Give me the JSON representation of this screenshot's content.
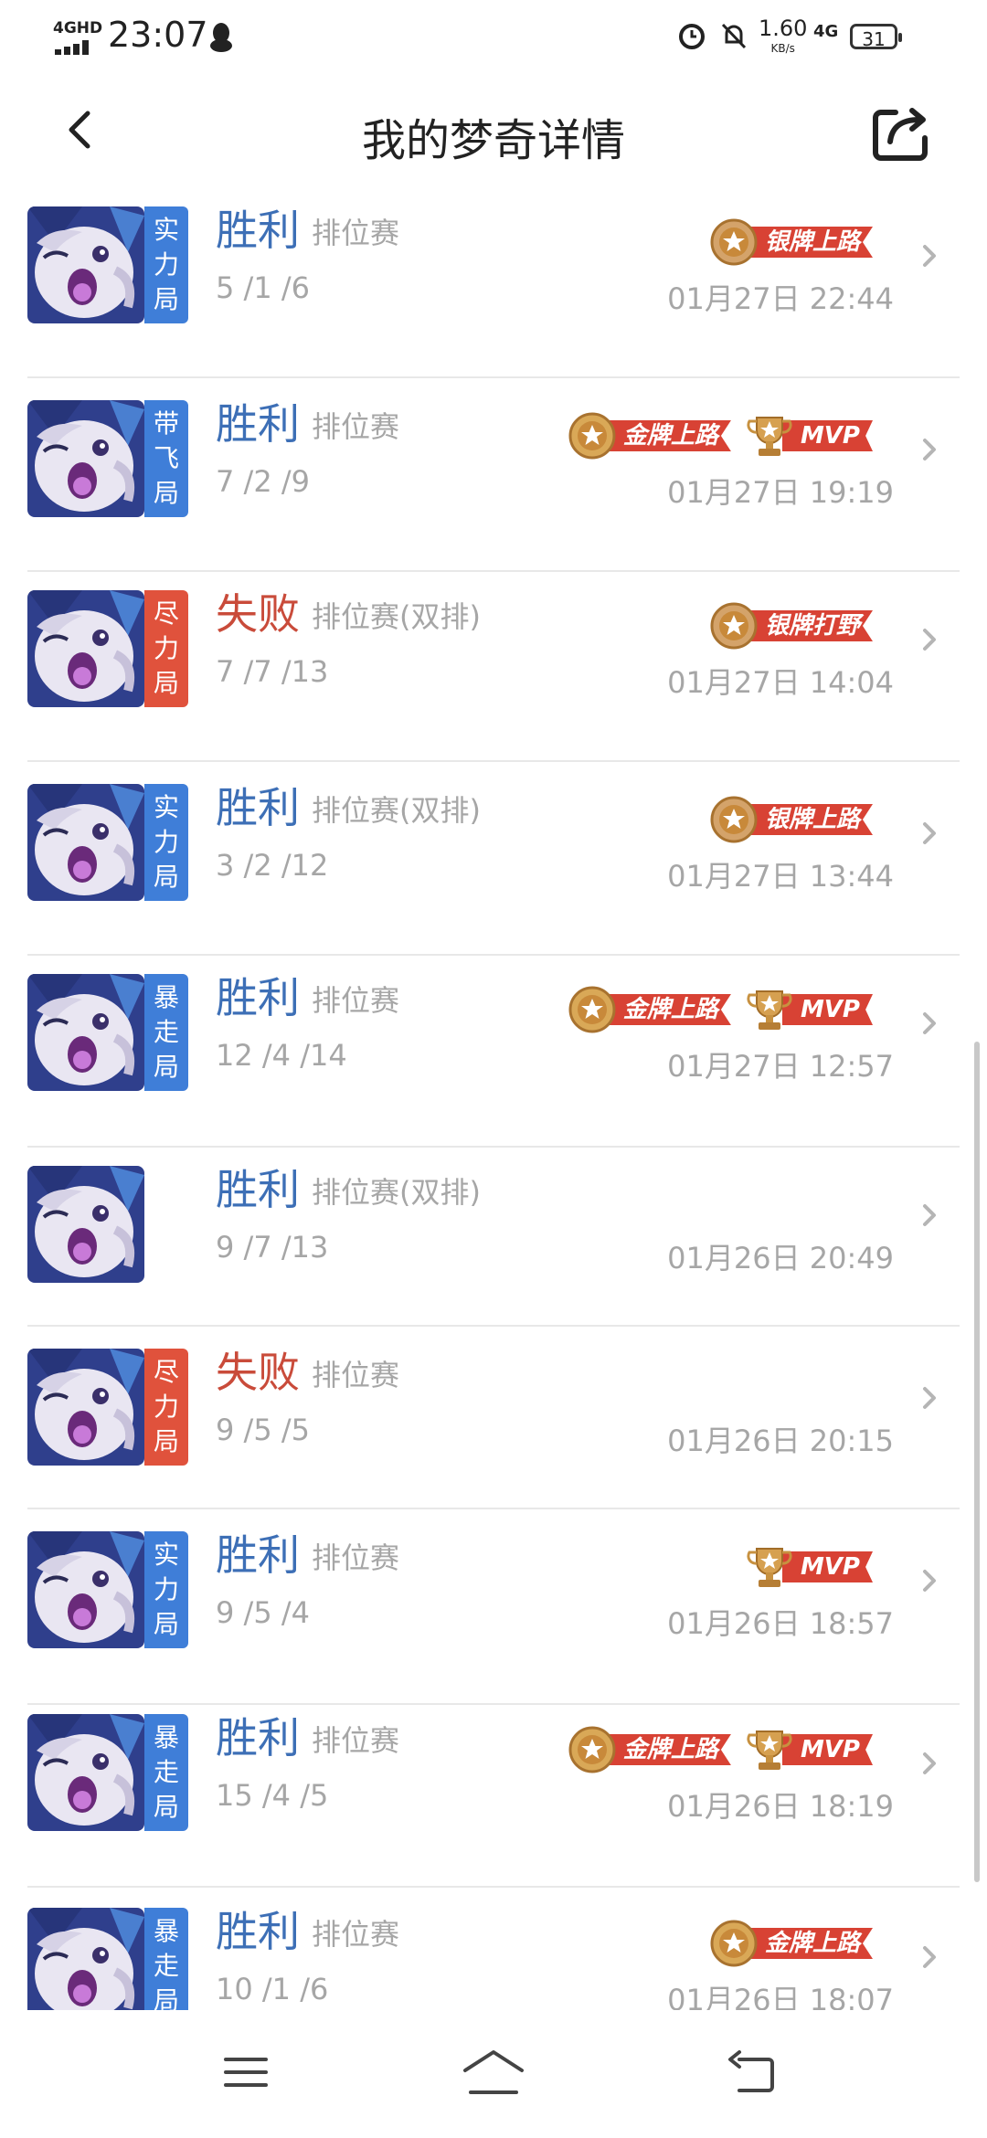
{
  "status_bar": {
    "network": "4GHD",
    "time": "23:07",
    "speed": "1.60",
    "speed_unit": "KB/s",
    "right_network": "4G",
    "battery": "31"
  },
  "header": {
    "title": "我的梦奇详情"
  },
  "matches": [
    {
      "tag": [
        "实",
        "力",
        "局"
      ],
      "tag_color": "#3f7ed8",
      "result": "胜利",
      "outcome": "win",
      "mode": "排位赛",
      "kda": "5 /1 /6",
      "time": "01月27日 22:44",
      "badges": [
        {
          "type": "silver",
          "label": "银牌上路"
        }
      ]
    },
    {
      "tag": [
        "带",
        "飞",
        "局"
      ],
      "tag_color": "#3f7ed8",
      "result": "胜利",
      "outcome": "win",
      "mode": "排位赛",
      "kda": "7 /2 /9",
      "time": "01月27日 19:19",
      "badges": [
        {
          "type": "gold",
          "label": "金牌上路"
        },
        {
          "type": "mvp",
          "label": "MVP"
        }
      ]
    },
    {
      "tag": [
        "尽",
        "力",
        "局"
      ],
      "tag_color": "#e0523c",
      "result": "失败",
      "outcome": "lose",
      "mode": "排位赛(双排)",
      "kda": "7 /7 /13",
      "time": "01月27日 14:04",
      "badges": [
        {
          "type": "silver",
          "label": "银牌打野"
        }
      ]
    },
    {
      "tag": [
        "实",
        "力",
        "局"
      ],
      "tag_color": "#3f7ed8",
      "result": "胜利",
      "outcome": "win",
      "mode": "排位赛(双排)",
      "kda": "3 /2 /12",
      "time": "01月27日 13:44",
      "badges": [
        {
          "type": "silver",
          "label": "银牌上路"
        }
      ]
    },
    {
      "tag": [
        "暴",
        "走",
        "局"
      ],
      "tag_color": "#3f7ed8",
      "result": "胜利",
      "outcome": "win",
      "mode": "排位赛",
      "kda": "12 /4 /14",
      "time": "01月27日 12:57",
      "badges": [
        {
          "type": "gold",
          "label": "金牌上路"
        },
        {
          "type": "mvp",
          "label": "MVP"
        }
      ]
    },
    {
      "tag": [],
      "tag_color": "",
      "result": "胜利",
      "outcome": "win",
      "mode": "排位赛(双排)",
      "kda": "9 /7 /13",
      "time": "01月26日 20:49",
      "badges": []
    },
    {
      "tag": [
        "尽",
        "力",
        "局"
      ],
      "tag_color": "#e0523c",
      "result": "失败",
      "outcome": "lose",
      "mode": "排位赛",
      "kda": "9 /5 /5",
      "time": "01月26日 20:15",
      "badges": []
    },
    {
      "tag": [
        "实",
        "力",
        "局"
      ],
      "tag_color": "#3f7ed8",
      "result": "胜利",
      "outcome": "win",
      "mode": "排位赛",
      "kda": "9 /5 /4",
      "time": "01月26日 18:57",
      "badges": [
        {
          "type": "mvp",
          "label": "MVP"
        }
      ]
    },
    {
      "tag": [
        "暴",
        "走",
        "局"
      ],
      "tag_color": "#3f7ed8",
      "result": "胜利",
      "outcome": "win",
      "mode": "排位赛",
      "kda": "15 /4 /5",
      "time": "01月26日 18:19",
      "badges": [
        {
          "type": "gold",
          "label": "金牌上路"
        },
        {
          "type": "mvp",
          "label": "MVP"
        }
      ]
    },
    {
      "tag": [
        "暴",
        "走",
        "局"
      ],
      "tag_color": "#3f7ed8",
      "result": "胜利",
      "outcome": "win",
      "mode": "排位赛",
      "kda": "10 /1 /6",
      "time": "01月26日 18:07",
      "badges": [
        {
          "type": "gold",
          "label": "金牌上路"
        }
      ]
    }
  ],
  "icons": {
    "back": "chevron-left-icon",
    "share": "share-icon",
    "row_arrow": "chevron-right-icon",
    "nav_menu": "menu-icon",
    "nav_home": "home-icon",
    "nav_back": "back-icon"
  },
  "colors": {
    "win": "#3d6fb6",
    "lose": "#c94b3a",
    "badge_ribbon": "#d84234"
  }
}
